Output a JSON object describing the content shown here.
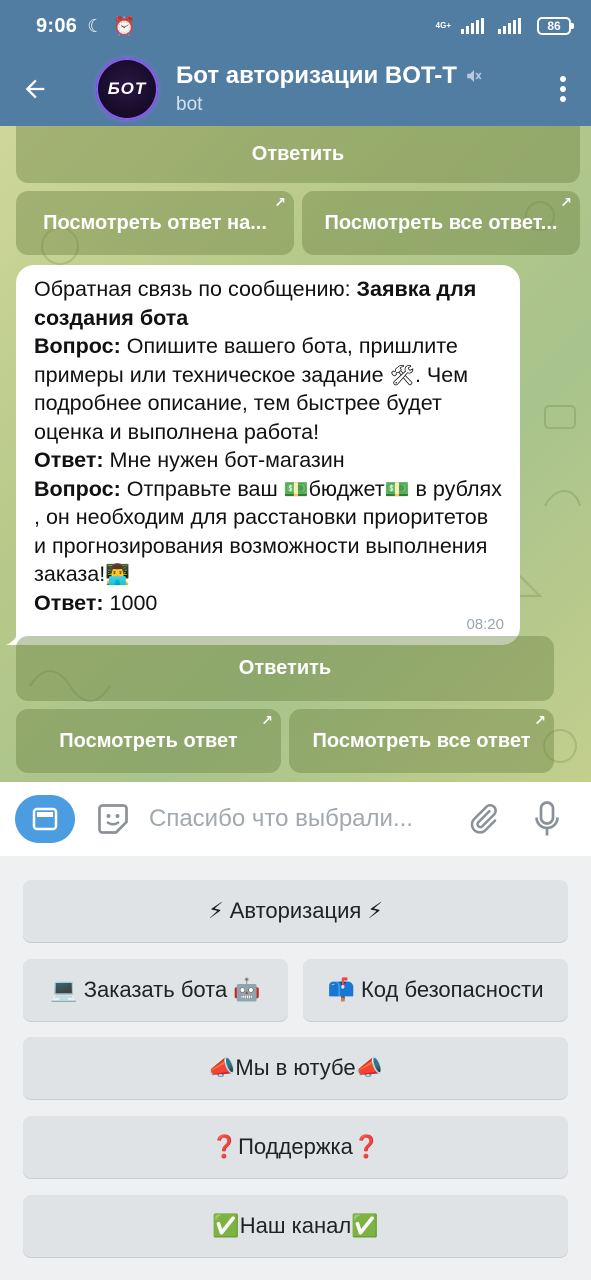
{
  "status_bar": {
    "time": "9:06",
    "network": "4G+",
    "battery": "86"
  },
  "header": {
    "avatar_text": "БОТ",
    "title": "Бот авторизации BOT-T",
    "subtitle": "bot"
  },
  "chat": {
    "top_reply_button": "Ответить",
    "top_view_answer": "Посмотреть ответ на...",
    "top_view_all": "Посмотреть все ответ...",
    "message": {
      "intro": "Обратная связь по сообщению: ",
      "intro_bold": "Заявка для создания бота",
      "q1_label": "Вопрос:",
      "q1_text": " Опишите вашего бота, пришлите примеры или техническое задание ",
      "q1_emoji": "🛠",
      "q1_text2": ". Чем подробнее описание, тем быстрее будет оценка и выполнена работа!",
      "a1_label": "Ответ:",
      "a1_text": " Мне нужен бот-магазин",
      "q2_label": "Вопрос:",
      "q2_text_a": " Отправьте ваш ",
      "q2_emoji": "💵",
      "q2_text_b": "бюджет",
      "q2_text_c": " в рублях , он необходим для расстановки приоритетов и прогнозирования возможности выполнения заказа!",
      "q2_emoji2": "👨‍💻",
      "a2_label": "Ответ:",
      "a2_text": " 1000",
      "time": "08:20"
    },
    "reply_button": "Ответить",
    "view_answer": "Посмотреть ответ",
    "view_all": "Посмотреть все ответ"
  },
  "input": {
    "placeholder": "Спасибо что выбрали..."
  },
  "reply_keyboard": {
    "authorization": "⚡ Авторизация ⚡",
    "order_bot": "💻 Заказать бота 🤖",
    "security_code": "📫 Код безопасности",
    "youtube": "📣Мы в ютубе📣",
    "support": "❓Поддержка❓",
    "channel": "✅Наш канал✅"
  },
  "colors": {
    "header": "#517da2",
    "accent": "#4c9ce2",
    "bubble": "#ffffff"
  }
}
